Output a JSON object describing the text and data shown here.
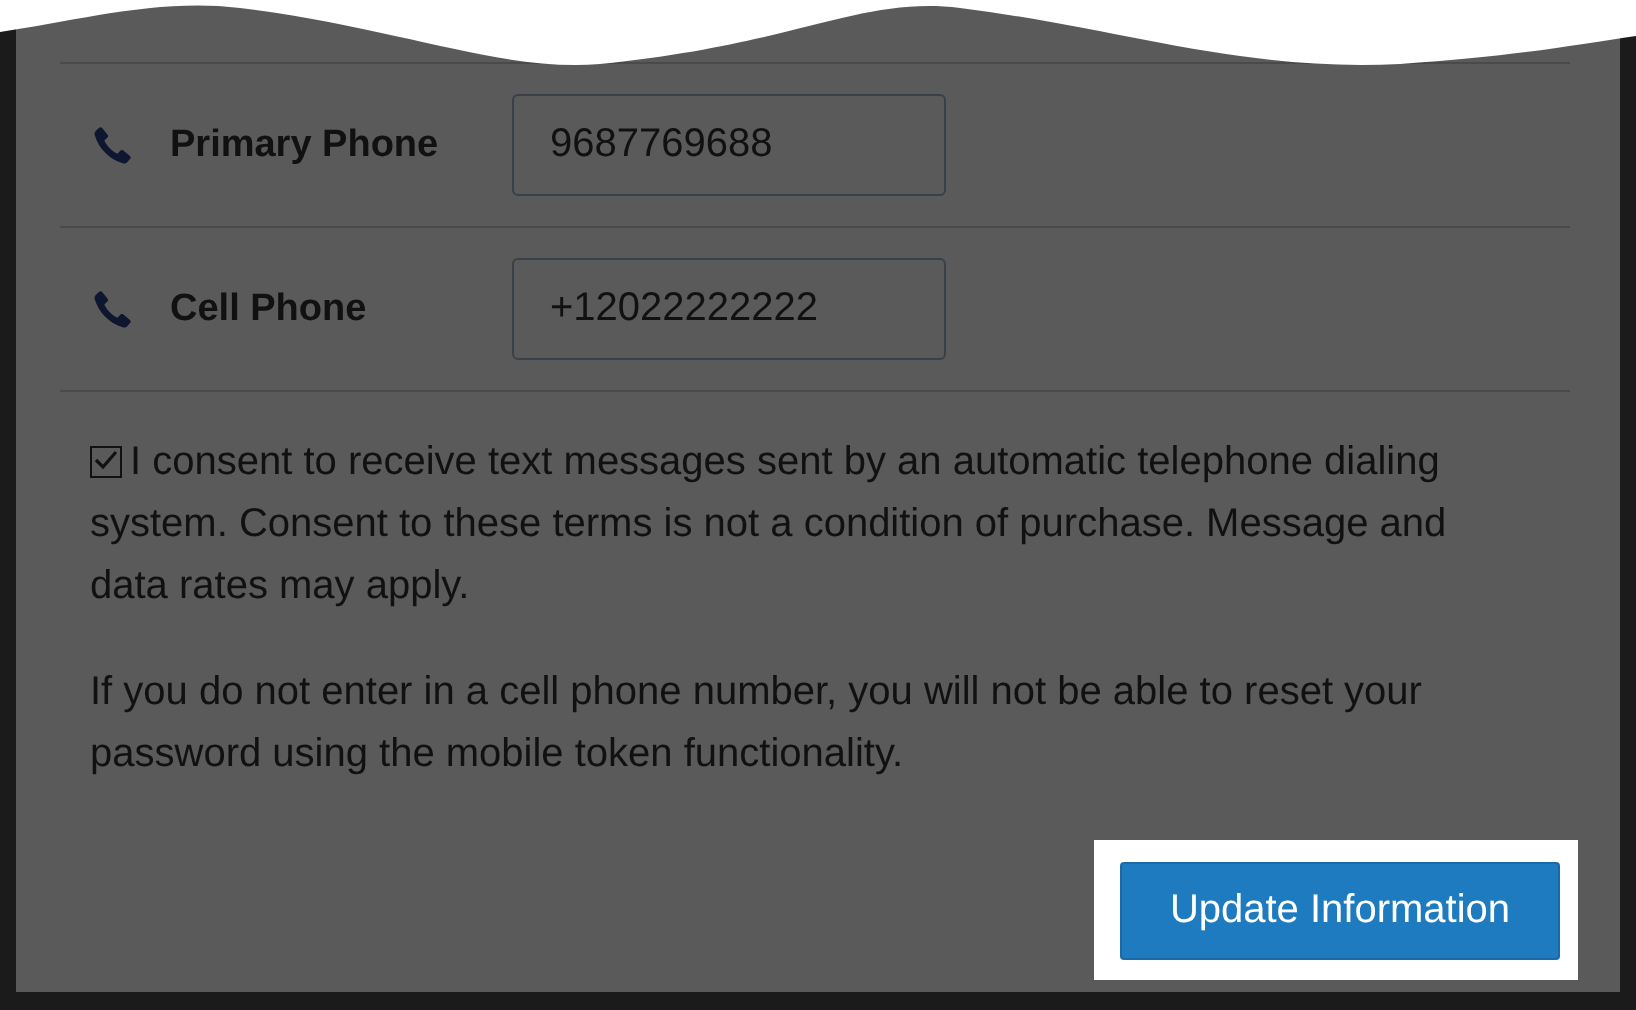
{
  "phones": [
    {
      "label": "Primary Phone",
      "value": "9687769688"
    },
    {
      "label": "Cell Phone",
      "value": "+12022222222"
    }
  ],
  "consent": {
    "checked": true,
    "text": "I consent to receive text messages sent by an automatic telephone dialing system. Consent to these terms is not a condition of purchase. Message and data rates may apply."
  },
  "note": "If you do not enter in a cell phone number, you will not be able to reset your password using the mobile token functionality.",
  "submit_button": {
    "label": "Update Information"
  }
}
